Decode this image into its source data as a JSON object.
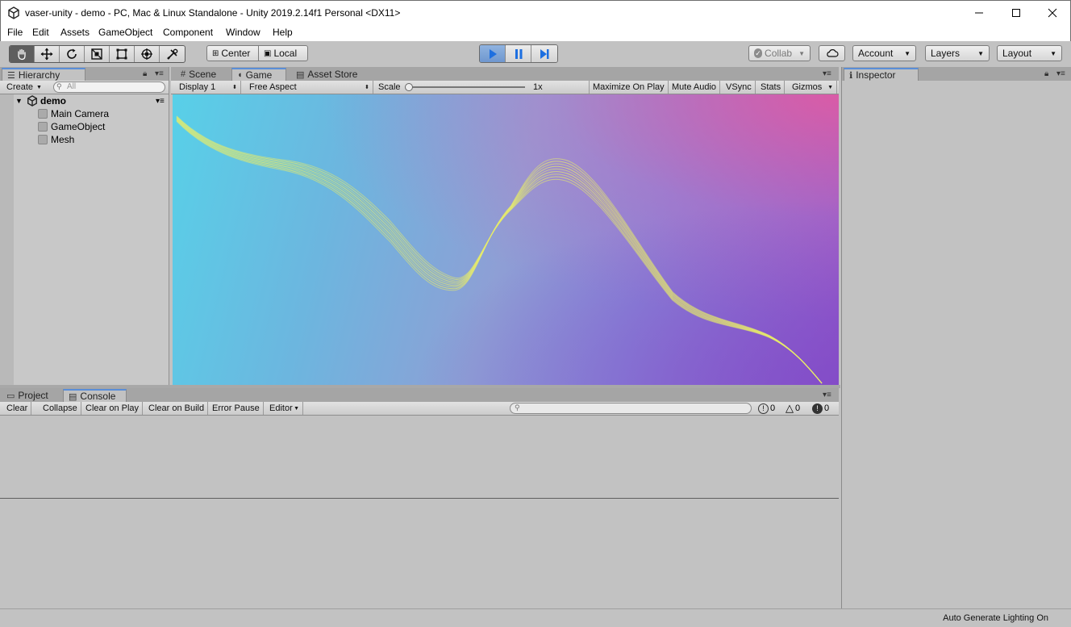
{
  "window": {
    "title": "vaser-unity - demo - PC, Mac & Linux Standalone - Unity 2019.2.14f1 Personal <DX11>"
  },
  "menu": [
    "File",
    "Edit",
    "Assets",
    "GameObject",
    "Component",
    "Window",
    "Help"
  ],
  "toolbar": {
    "tools": [
      "hand-tool-icon",
      "move-tool-icon",
      "rotate-tool-icon",
      "scale-tool-icon",
      "rect-tool-icon",
      "transform-tool-icon",
      "custom-tool-icon"
    ],
    "pivot_label": "Center",
    "space_label": "Local",
    "collab_label": "Collab",
    "account_label": "Account",
    "layers_label": "Layers",
    "layout_label": "Layout"
  },
  "hierarchy": {
    "tab_label": "Hierarchy",
    "create_label": "Create",
    "search_placeholder": "All",
    "scene_name": "demo",
    "items": [
      "Main Camera",
      "GameObject",
      "Mesh"
    ]
  },
  "game": {
    "tabs": [
      "Scene",
      "Game",
      "Asset Store"
    ],
    "active_tab": "Game",
    "display_label": "Display 1",
    "aspect_label": "Free Aspect",
    "scale_label": "Scale",
    "scale_value": "1x",
    "scale_slider_value": 0,
    "options": [
      "Maximize On Play",
      "Mute Audio",
      "VSync",
      "Stats",
      "Gizmos"
    ]
  },
  "inspector": {
    "tab_label": "Inspector"
  },
  "console": {
    "tabs": [
      "Project",
      "Console"
    ],
    "active_tab": "Console",
    "buttons": [
      "Clear",
      "Collapse",
      "Clear on Play",
      "Clear on Build",
      "Error Pause",
      "Editor"
    ],
    "info_count": "0",
    "warning_count": "0",
    "error_count": "0"
  },
  "status": {
    "text": "Auto Generate Lighting On"
  },
  "colors": {
    "accent": "#5a8ed8",
    "play_active": "#7aa2d8",
    "curve": "#e8ec6a"
  }
}
